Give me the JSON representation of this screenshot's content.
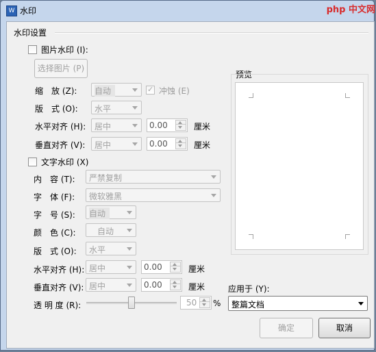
{
  "window": {
    "title": "水印",
    "app_icon_letter": "W",
    "watermark_text": "php 中文网"
  },
  "watermark_settings": {
    "group_label": "水印设置",
    "picture": {
      "checkbox_label": "图片水印 (I):",
      "checked": false,
      "select_button": "选择图片 (P)",
      "scale_label": "缩　放 (Z):",
      "scale_value": "自动",
      "washout_label": "冲蚀 (E)",
      "washout_checked": true,
      "layout_label": "版　式 (O):",
      "layout_value": "水平",
      "h_align_label": "水平对齐 (H):",
      "h_align_value": "居中",
      "h_offset": "0.00",
      "h_unit": "厘米",
      "v_align_label": "垂直对齐 (V):",
      "v_align_value": "居中",
      "v_offset": "0.00",
      "v_unit": "厘米"
    },
    "text": {
      "checkbox_label": "文字水印 (X)",
      "checked": false,
      "content_label": "内　容 (T):",
      "content_value": "严禁复制",
      "font_label": "字　体 (F):",
      "font_value": "微软雅黑",
      "size_label": "字　号 (S):",
      "size_value": "自动",
      "color_label": "颜　色 (C):",
      "color_value": "自动",
      "layout_label": "版　式 (O):",
      "layout_value": "水平",
      "h_align_label": "水平对齐 (H):",
      "h_align_value": "居中",
      "h_offset": "0.00",
      "h_unit": "厘米",
      "v_align_label": "垂直对齐 (V):",
      "v_align_value": "居中",
      "v_offset": "0.00",
      "v_unit": "厘米",
      "transparency_label": "透 明 度 (R):",
      "transparency_value": "50",
      "transparency_unit": "%",
      "transparency_level": 50
    }
  },
  "preview": {
    "label": "预览"
  },
  "apply_to": {
    "label": "应用于 (Y):",
    "value": "整篇文档"
  },
  "buttons": {
    "ok": "确定",
    "cancel": "取消"
  },
  "colors": {
    "title_bar": "#c5d6ec",
    "client_bg": "#f0f0f0",
    "disabled_text": "#9a9a9a",
    "php_watermark": "#d82b2b"
  }
}
